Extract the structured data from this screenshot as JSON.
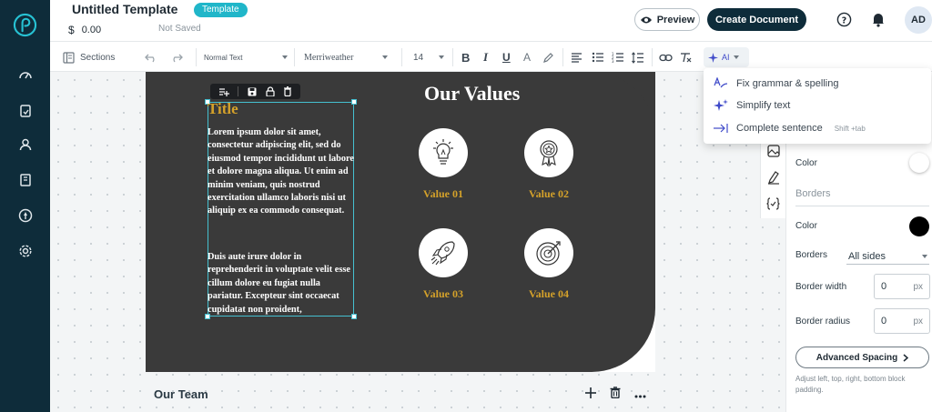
{
  "header": {
    "doc_title": "Untitled Template",
    "badge": "Template",
    "price": "0.00",
    "save_status": "Not Saved",
    "preview_label": "Preview",
    "create_label": "Create Document",
    "avatar_initials": "AD"
  },
  "sidebar": {
    "items": [
      {
        "icon": "dashboard-icon"
      },
      {
        "icon": "documents-icon"
      },
      {
        "icon": "user-icon"
      },
      {
        "icon": "library-icon"
      },
      {
        "icon": "rocket-icon"
      },
      {
        "icon": "gear-icon"
      }
    ]
  },
  "toolbar": {
    "sections_label": "Sections",
    "text_style": "Normal Text",
    "font_family": "Merriweather",
    "font_size": "14",
    "ai_label": "AI"
  },
  "ai_menu": {
    "items": [
      {
        "label": "Fix grammar & spelling",
        "hint": ""
      },
      {
        "label": "Simplify text",
        "hint": ""
      },
      {
        "label": "Complete sentence",
        "hint": "Shift +tab"
      }
    ]
  },
  "content": {
    "title": "Title",
    "paragraph1": "Lorem ipsum dolor sit amet, consectetur adipiscing elit, sed do eiusmod tempor incididunt ut labore et dolore magna aliqua. Ut enim ad minim veniam, quis nostrud exercitation ullamco laboris nisi ut aliquip ex ea commodo consequat.",
    "paragraph2": "Duis aute irure dolor in reprehenderit in voluptate velit esse cillum dolore eu fugiat nulla pariatur. Excepteur sint occaecat cupidatat non proident,",
    "values_title": "Our Values",
    "values": [
      {
        "label": "Value 01",
        "icon": "lightbulb-icon"
      },
      {
        "label": "Value 02",
        "icon": "award-icon"
      },
      {
        "label": "Value 03",
        "icon": "rocket-icon"
      },
      {
        "label": "Value 04",
        "icon": "target-icon"
      }
    ],
    "next_section": "Our Team"
  },
  "panel": {
    "color_label": "Color",
    "borders_heading": "Borders",
    "border_color_label": "Color",
    "borders_label": "Borders",
    "borders_value": "All sides",
    "border_width_label": "Border width",
    "border_width_value": "0",
    "border_radius_label": "Border radius",
    "border_radius_value": "0",
    "unit": "px",
    "advanced_label": "Advanced Spacing",
    "advanced_note": "Adjust left, top, right, bottom block padding."
  },
  "colors": {
    "rail": "#0e2c3a",
    "accent": "#20b6c9",
    "gold": "#d4a12a",
    "dark_section": "#3a3a3a"
  }
}
